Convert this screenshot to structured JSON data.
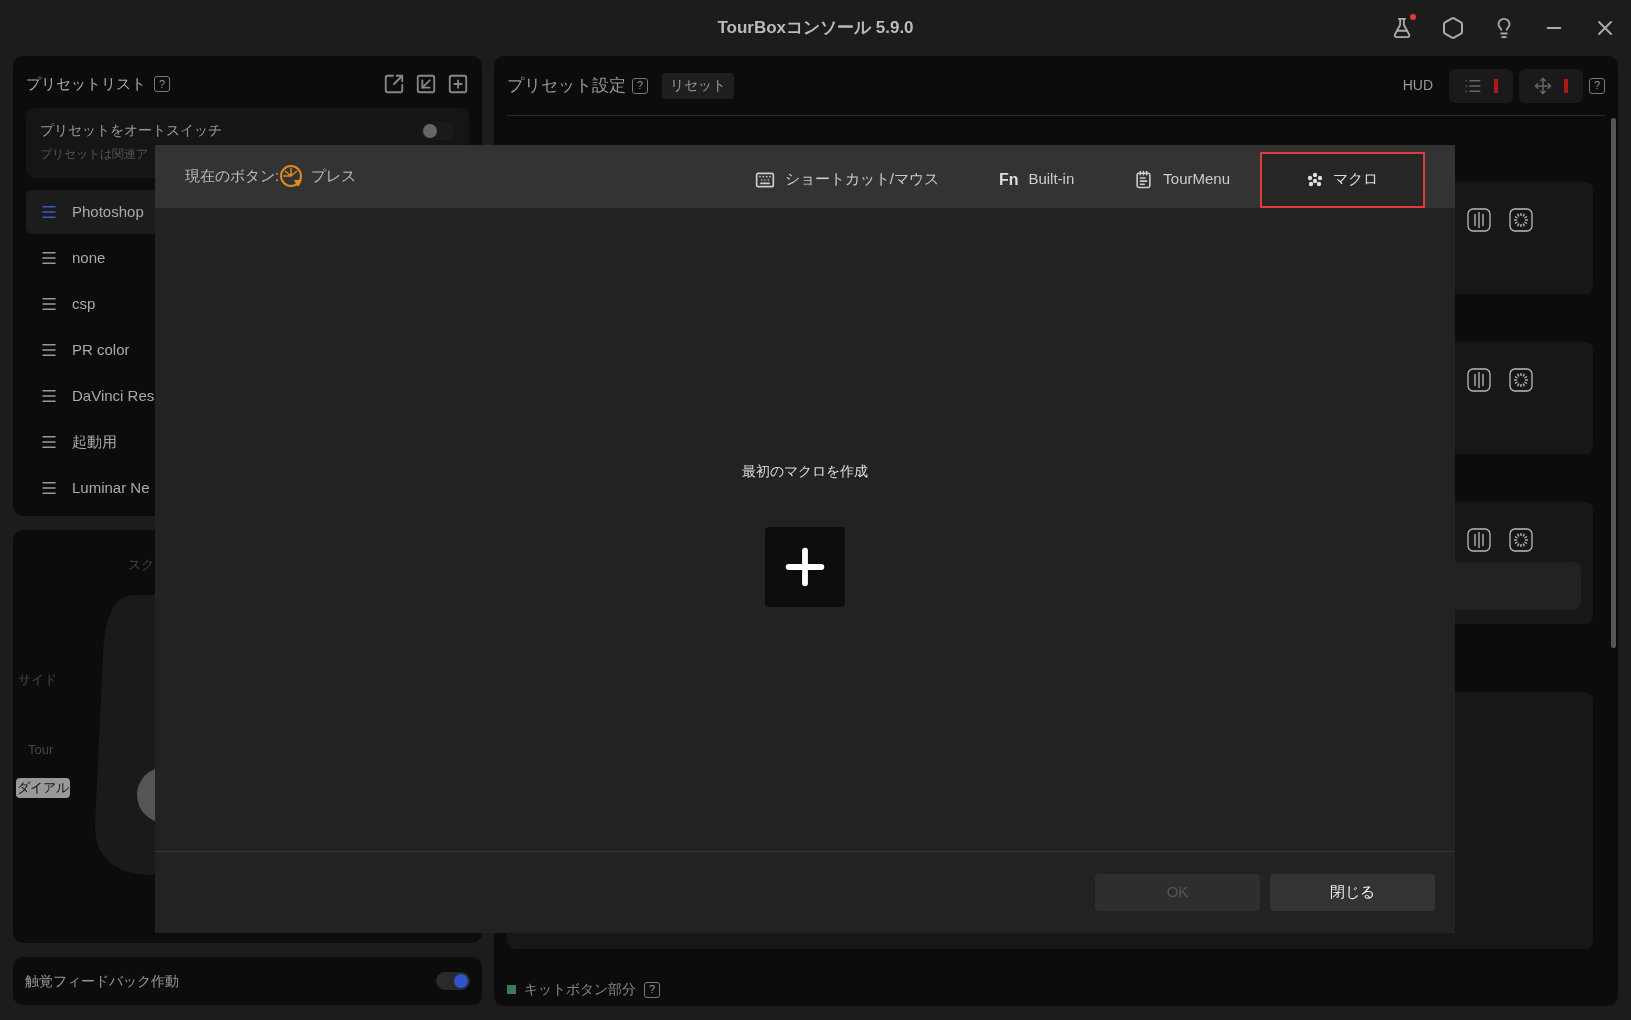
{
  "window": {
    "title": "TourBoxコンソール 5.9.0",
    "lab_notification": true
  },
  "preset_list": {
    "title": "プリセットリスト",
    "help": "?",
    "auto_switch": {
      "label": "プリセットをオートスイッチ",
      "description": "プリセットは関連ア",
      "on": false
    },
    "presets": [
      {
        "name": "Photoshop",
        "selected": true
      },
      {
        "name": "none",
        "selected": false
      },
      {
        "name": "csp",
        "selected": false
      },
      {
        "name": "PR color",
        "selected": false
      },
      {
        "name": "DaVinci Res",
        "selected": false
      },
      {
        "name": "起動用",
        "selected": false
      },
      {
        "name": "Luminar Ne",
        "selected": false
      }
    ]
  },
  "device_panel": {
    "labels": [
      {
        "text": "スク",
        "selected": false
      },
      {
        "text": "サイド",
        "selected": false
      },
      {
        "text": "Tour",
        "selected": false
      },
      {
        "text": "ダイアル",
        "selected": true
      }
    ]
  },
  "haptic": {
    "label": "触覚フィードバック作動",
    "on": true
  },
  "preset_settings": {
    "title": "プリセット設定",
    "help": "?",
    "reset": "リセット",
    "hud": "HUD",
    "help_right": "?",
    "kit_section": {
      "label": "キットボタン部分",
      "help": "?",
      "color": "#3d7a55"
    }
  },
  "dialog": {
    "current_button_label": "現在のボタン:",
    "current_button": "プレス",
    "tabs": [
      {
        "label": "ショートカット/マウス",
        "kind": "shortcut",
        "selected": false
      },
      {
        "label": "Built-in",
        "kind": "builtin",
        "icon_text": "Fn",
        "selected": false
      },
      {
        "label": "TourMenu",
        "kind": "tourmenu",
        "selected": false
      },
      {
        "label": "マクロ",
        "kind": "macro",
        "selected": true
      }
    ],
    "empty_message": "最初のマクロを作成",
    "ok": {
      "label": "OK",
      "disabled": true
    },
    "close": "閉じる"
  }
}
